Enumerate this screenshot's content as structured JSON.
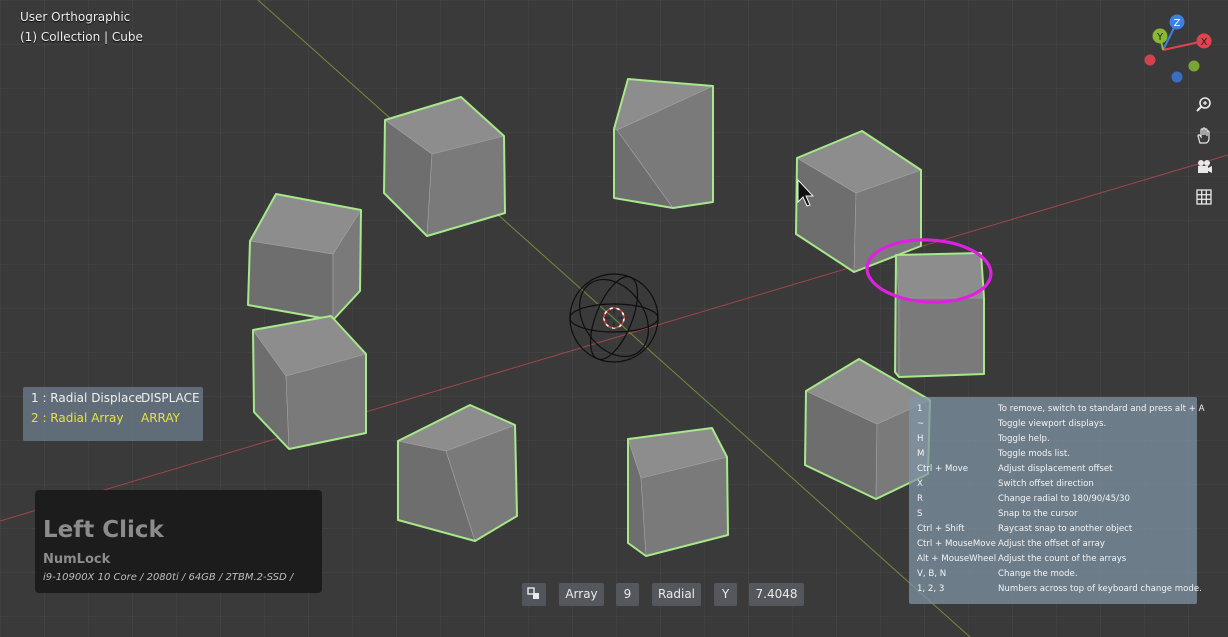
{
  "viewport": {
    "view_name": "User Orthographic",
    "collection_line": "(1) Collection | Cube"
  },
  "gizmo": {
    "axis_z": "Z",
    "axis_y": "Y",
    "axis_x": "X",
    "colors": {
      "x": "#e2434f",
      "y": "#8ab833",
      "z": "#3b82e0"
    }
  },
  "nav_tools": [
    {
      "icon": "zoom-icon"
    },
    {
      "icon": "hand-pan-icon"
    },
    {
      "icon": "camera-icon"
    },
    {
      "icon": "grid-icon"
    }
  ],
  "modifiers": [
    {
      "label": "1 : Radial Displace",
      "type": "DISPLACE",
      "color": "#f0f0f0"
    },
    {
      "label": "2 : Radial Array",
      "type": "ARRAY",
      "color": "#e6e23a"
    }
  ],
  "key_overlay": {
    "main": "Left Click",
    "sub": "NumLock",
    "specs": "i9-10900X 10 Core / 2080ti / 64GB / 2TBM.2-SSD /"
  },
  "status_chips": {
    "icon": "array-icon",
    "mode": "Array",
    "count": "9",
    "shape": "Radial",
    "axis": "Y",
    "offset": "7.4048"
  },
  "help": [
    {
      "key": "1",
      "desc": "To remove, switch to standard and press alt + A"
    },
    {
      "key": "~",
      "desc": "Toggle viewport displays."
    },
    {
      "key": "H",
      "desc": "Toggle help."
    },
    {
      "key": "M",
      "desc": "Toggle mods list."
    },
    {
      "key": "Ctrl + Move",
      "desc": "Adjust displacement offset"
    },
    {
      "key": "X",
      "desc": "Switch offset direction"
    },
    {
      "key": "R",
      "desc": "Change radial to 180/90/45/30"
    },
    {
      "key": "S",
      "desc": "Snap to the cursor"
    },
    {
      "key": "Ctrl + Shift",
      "desc": "Raycast snap to another object"
    },
    {
      "key": "Ctrl + MouseMove",
      "desc": "Adjust the offset of array"
    },
    {
      "key": "Alt + MouseWheel",
      "desc": "Adjust the count of the arrays"
    },
    {
      "key": "V, B, N",
      "desc": "Change the mode."
    },
    {
      "key": "1, 2, 3",
      "desc": "Numbers across top of keyboard change mode."
    }
  ],
  "colors": {
    "selection_outline": "#a6e88a",
    "annotation": "#e020e0",
    "cube_top": "#8d8d8d",
    "cube_left": "#6e6e6e",
    "cube_right": "#7a7a7a"
  }
}
